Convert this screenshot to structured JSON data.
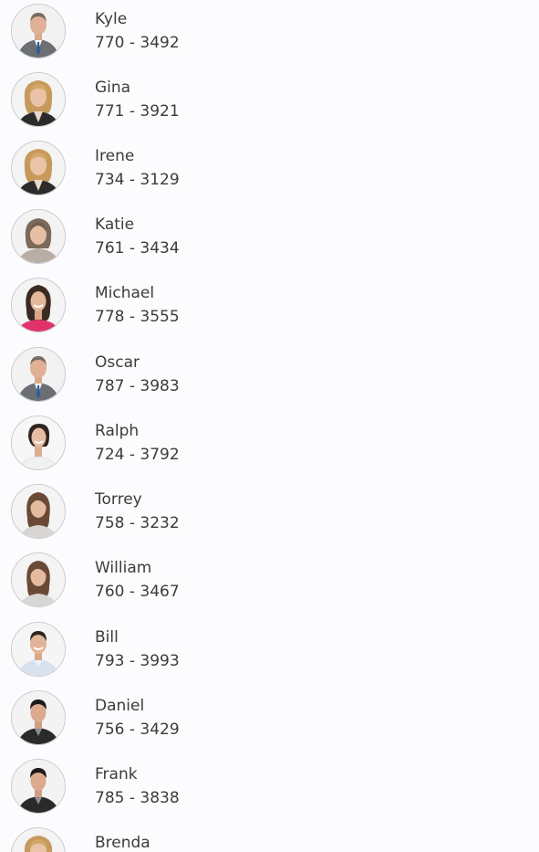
{
  "contacts": [
    {
      "name": "Kyle",
      "phone": "770 - 3492",
      "avatar": "avatar-man-suit"
    },
    {
      "name": "Gina",
      "phone": "771 - 3921",
      "avatar": "avatar-woman-blonde"
    },
    {
      "name": "Irene",
      "phone": "734 - 3129",
      "avatar": "avatar-woman-blonde"
    },
    {
      "name": "Katie",
      "phone": "761 - 3434",
      "avatar": "avatar-woman-gray"
    },
    {
      "name": "Michael",
      "phone": "778 - 3555",
      "avatar": "avatar-woman-pink"
    },
    {
      "name": "Oscar",
      "phone": "787 - 3983",
      "avatar": "avatar-man-suit"
    },
    {
      "name": "Ralph",
      "phone": "724 - 3792",
      "avatar": "avatar-woman-white"
    },
    {
      "name": "Torrey",
      "phone": "758 - 3232",
      "avatar": "avatar-woman-brunette"
    },
    {
      "name": "William",
      "phone": "760 - 3467",
      "avatar": "avatar-woman-brunette"
    },
    {
      "name": "Bill",
      "phone": "793 - 3993",
      "avatar": "avatar-man-shirt"
    },
    {
      "name": "Daniel",
      "phone": "756 - 3429",
      "avatar": "avatar-man-dark"
    },
    {
      "name": "Frank",
      "phone": "785 - 3838",
      "avatar": "avatar-man-dark"
    },
    {
      "name": "Brenda",
      "phone": "",
      "avatar": "avatar-woman-blonde"
    }
  ],
  "colors": {
    "background": "#fcfbfe",
    "text": "#3c3c3c",
    "avatar_border": "#c9c9cf"
  }
}
